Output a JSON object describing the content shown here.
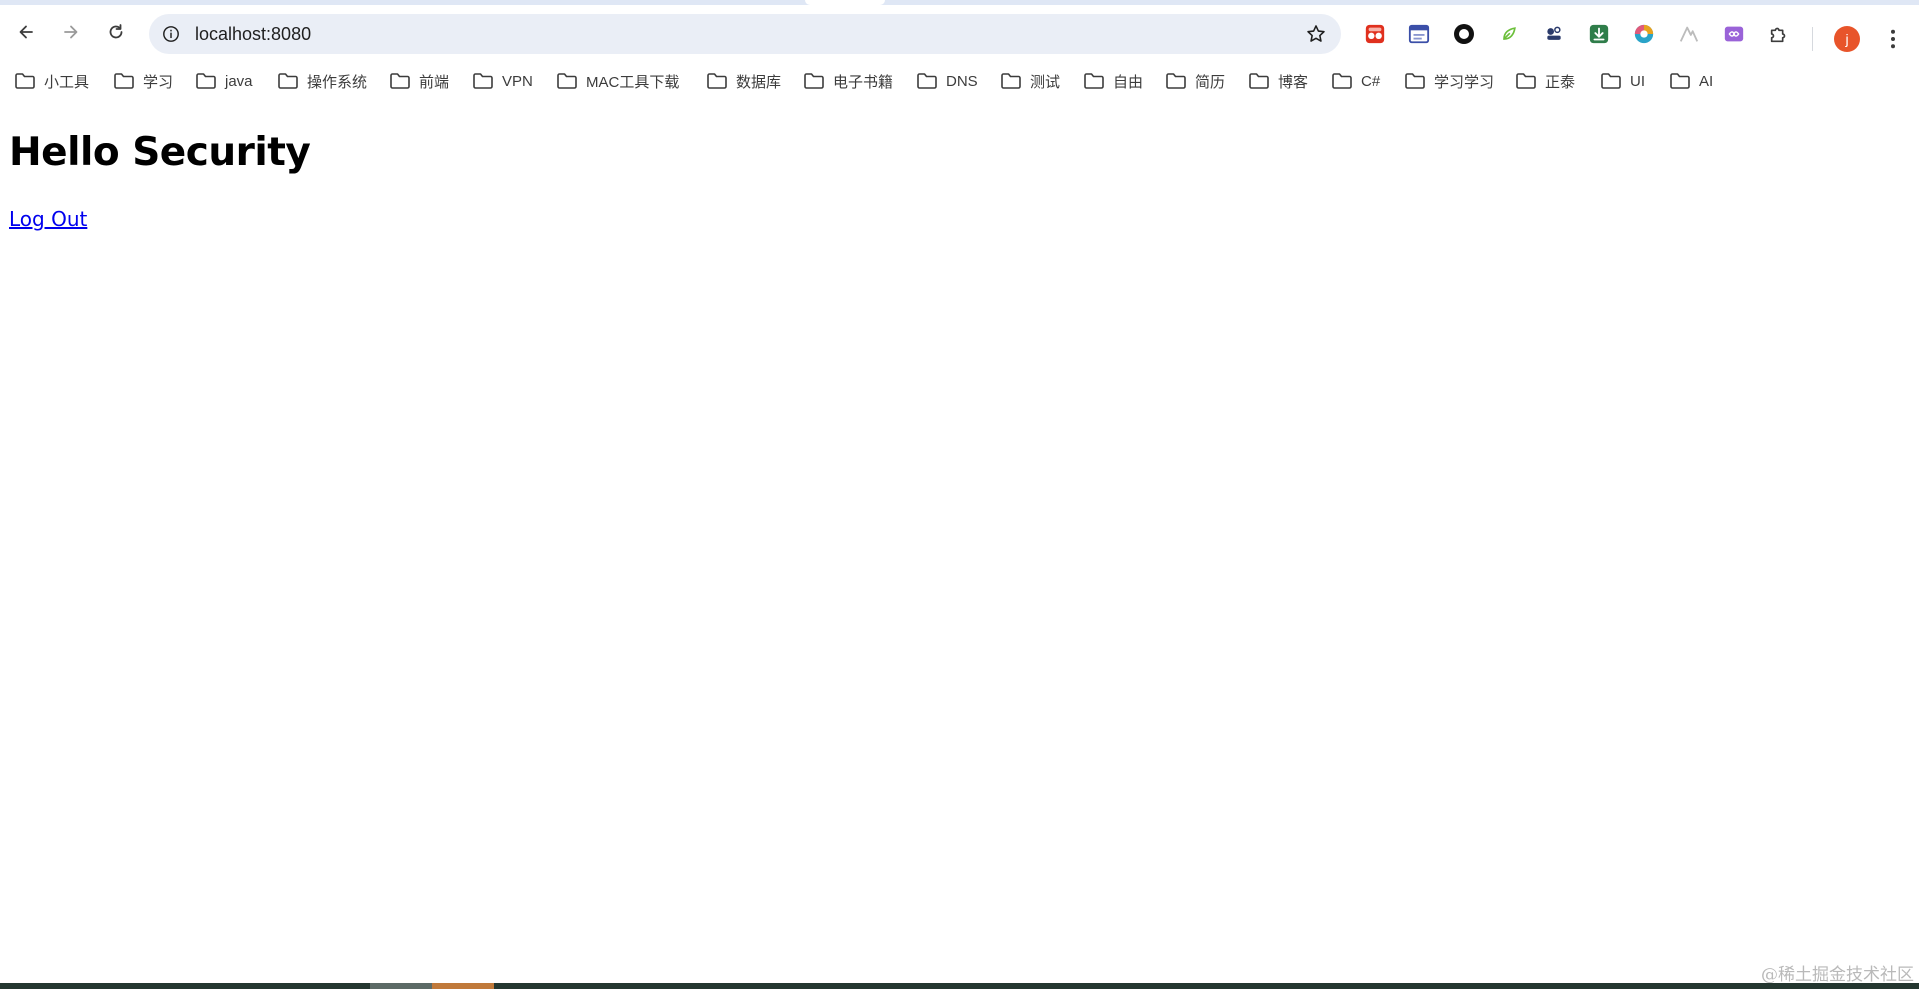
{
  "browser": {
    "address_bar": {
      "url": "localhost:8080"
    },
    "profile_initial": "j",
    "extensions": [
      {
        "icon": "red-grid-extension-icon",
        "color": "#e0301e"
      },
      {
        "icon": "window-extension-icon",
        "color": "#3b4fa8"
      },
      {
        "icon": "black-circle-extension-icon",
        "color": "#111111"
      },
      {
        "icon": "green-leaf-extension-icon",
        "color": "#6bbf3a"
      },
      {
        "icon": "dark-blue-extension-icon",
        "color": "#2a3a6b"
      },
      {
        "icon": "download-extension-icon",
        "color": "#2f7d4a"
      },
      {
        "icon": "colorful-globe-extension-icon",
        "color": "#e8a21e"
      },
      {
        "icon": "grey-peak-extension-icon",
        "color": "#bcbcbc"
      },
      {
        "icon": "infinity-extension-icon",
        "color": "#9a63d8"
      },
      {
        "icon": "puzzle-extensions-icon",
        "color": "#3c3c3c"
      }
    ],
    "bookmarks": [
      "小工具",
      "学习",
      "java",
      "操作系统",
      "前端",
      "VPN",
      "MAC工具下载",
      "数据库",
      "电子书籍",
      "DNS",
      "测试",
      "自由",
      "简历",
      "博客",
      "C#",
      "学习学习",
      "正泰",
      "UI",
      "AI"
    ]
  },
  "page": {
    "heading": "Hello Security",
    "logout_link": "Log Out"
  },
  "watermark": "@稀土掘金技术社区"
}
